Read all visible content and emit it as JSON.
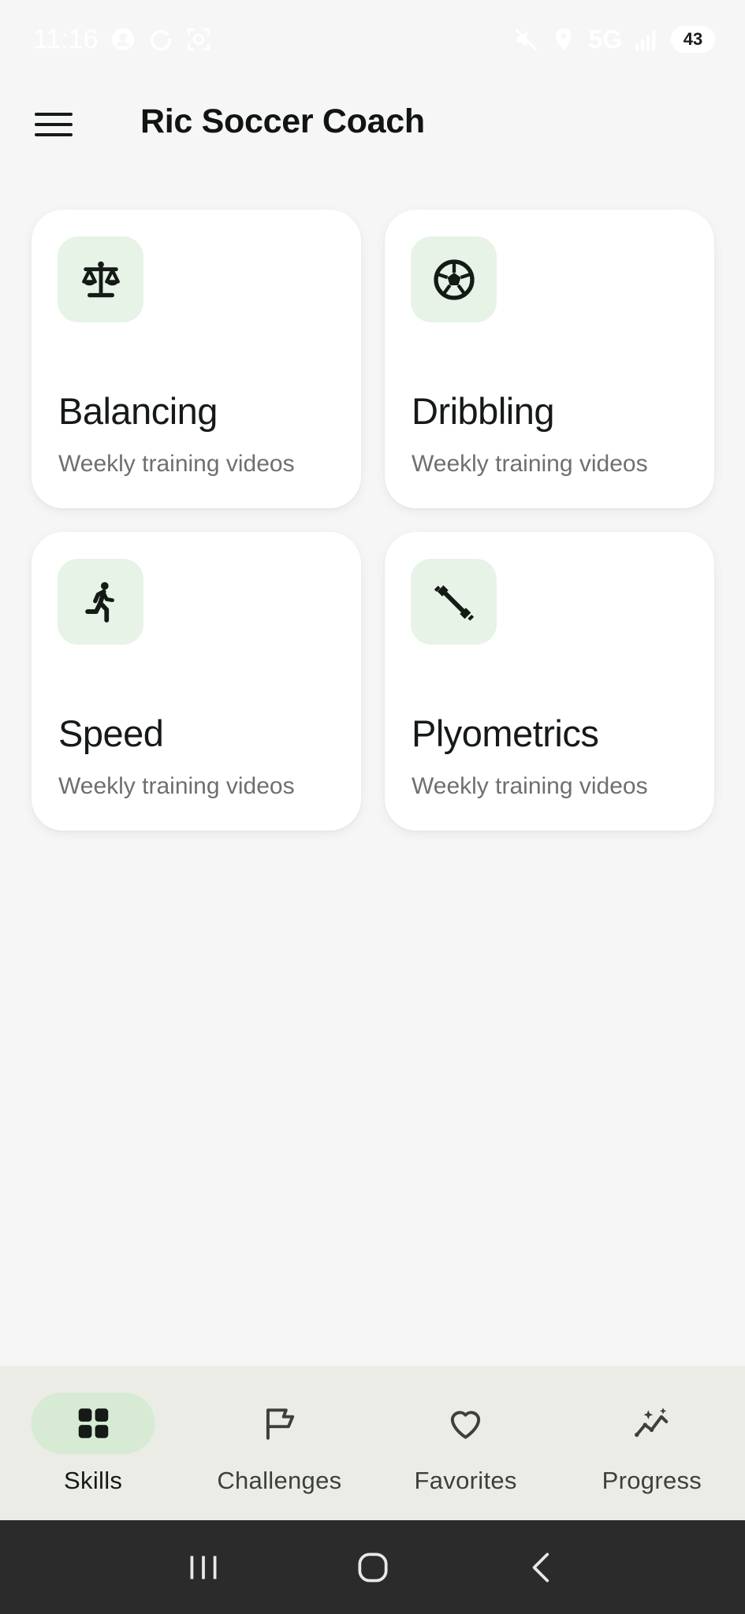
{
  "status_bar": {
    "time": "11:16",
    "network": "5G",
    "battery": "43",
    "left_icons": [
      "face-icon",
      "sync-icon",
      "screenshot-icon"
    ],
    "right_icons": [
      "mute-icon",
      "location-icon",
      "signal-icon"
    ]
  },
  "app_bar": {
    "title": "Ric Soccer Coach",
    "menu_icon": "menu-icon"
  },
  "skills": [
    {
      "title": "Balancing",
      "subtitle": "Weekly training videos",
      "icon": "scale-icon"
    },
    {
      "title": "Dribbling",
      "subtitle": "Weekly training videos",
      "icon": "soccer-ball-icon"
    },
    {
      "title": "Speed",
      "subtitle": "Weekly training videos",
      "icon": "running-icon"
    },
    {
      "title": "Plyometrics",
      "subtitle": "Weekly training videos",
      "icon": "dumbbell-icon"
    }
  ],
  "bottom_nav": [
    {
      "label": "Skills",
      "icon": "grid-icon",
      "active": true
    },
    {
      "label": "Challenges",
      "icon": "flag-icon",
      "active": false
    },
    {
      "label": "Favorites",
      "icon": "heart-icon",
      "active": false
    },
    {
      "label": "Progress",
      "icon": "trend-icon",
      "active": false
    }
  ],
  "colors": {
    "background": "#f6f6f6",
    "card": "#ffffff",
    "icon_tile": "#e6f3e6",
    "nav_background": "#ecece6",
    "nav_active_pill": "#d6ead4",
    "system_nav": "#2b2b2b"
  }
}
